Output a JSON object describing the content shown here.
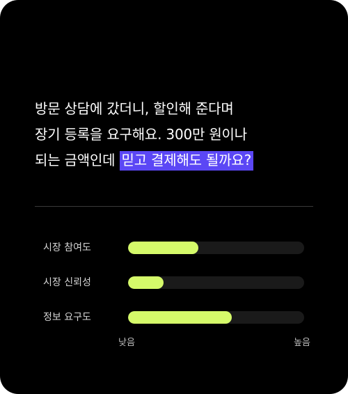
{
  "question": {
    "line1": "방문 상담에 갔더니, 할인해 준다며",
    "line2": "장기 등록을 요구해요. 300만 원이나",
    "line3_plain": "되는 금액인데 ",
    "line3_highlight": "믿고 결제해도 될까요?"
  },
  "metrics": [
    {
      "label": "시장 참여도",
      "level_percent": 40
    },
    {
      "label": "시장 신뢰성",
      "level_percent": 20
    },
    {
      "label": "정보 요구도",
      "level_percent": 59
    }
  ],
  "scale": {
    "low": "낮음",
    "high": "높음"
  },
  "colors": {
    "background": "#000000",
    "highlight": "#5b47f5",
    "bar_fill": "#d5fa6a",
    "bar_track": "#1a1a1a"
  }
}
